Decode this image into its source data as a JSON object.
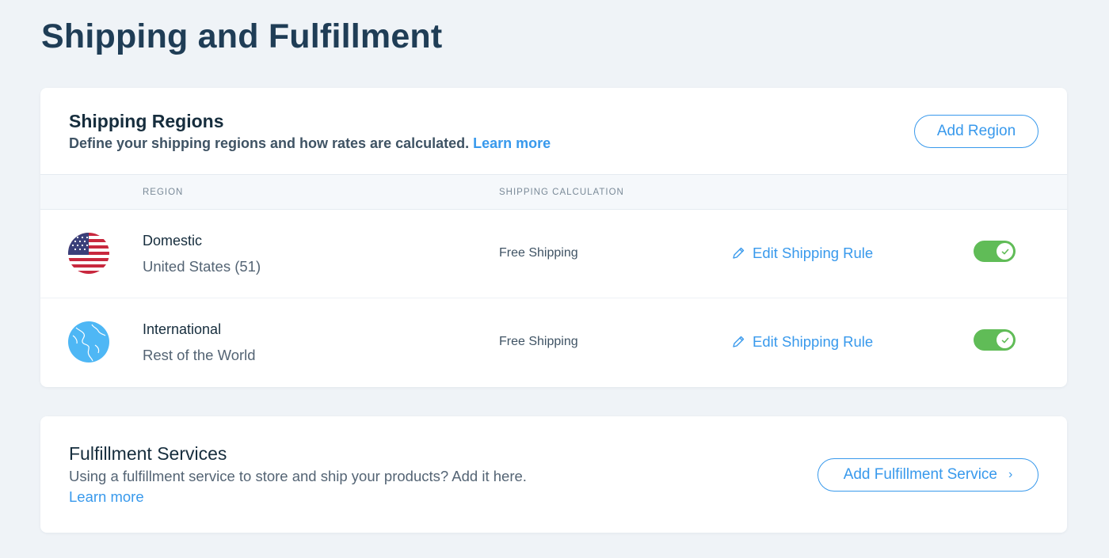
{
  "page": {
    "title": "Shipping and Fulfillment"
  },
  "regions_card": {
    "title": "Shipping Regions",
    "subtitle": "Define your shipping regions and how rates are calculated.",
    "learn_more": "Learn more",
    "add_button": "Add Region",
    "columns": {
      "region": "REGION",
      "calculation": "SHIPPING CALCULATION"
    },
    "rows": [
      {
        "icon": "us-flag-icon",
        "name": "Domestic",
        "description": "United States (51)",
        "calculation": "Free Shipping",
        "edit_label": "Edit Shipping Rule",
        "enabled": true
      },
      {
        "icon": "globe-icon",
        "name": "International",
        "description": "Rest of the World",
        "calculation": "Free Shipping",
        "edit_label": "Edit Shipping Rule",
        "enabled": true
      }
    ]
  },
  "fulfillment_card": {
    "title": "Fulfillment Services",
    "body": "Using a fulfillment service to store and ship your products? Add it here.",
    "learn_more": "Learn more",
    "add_button": "Add Fulfillment Service"
  },
  "colors": {
    "accent": "#3899ec",
    "toggle_on": "#60bc57",
    "title": "#1f3d56",
    "background": "#eff3f7"
  }
}
